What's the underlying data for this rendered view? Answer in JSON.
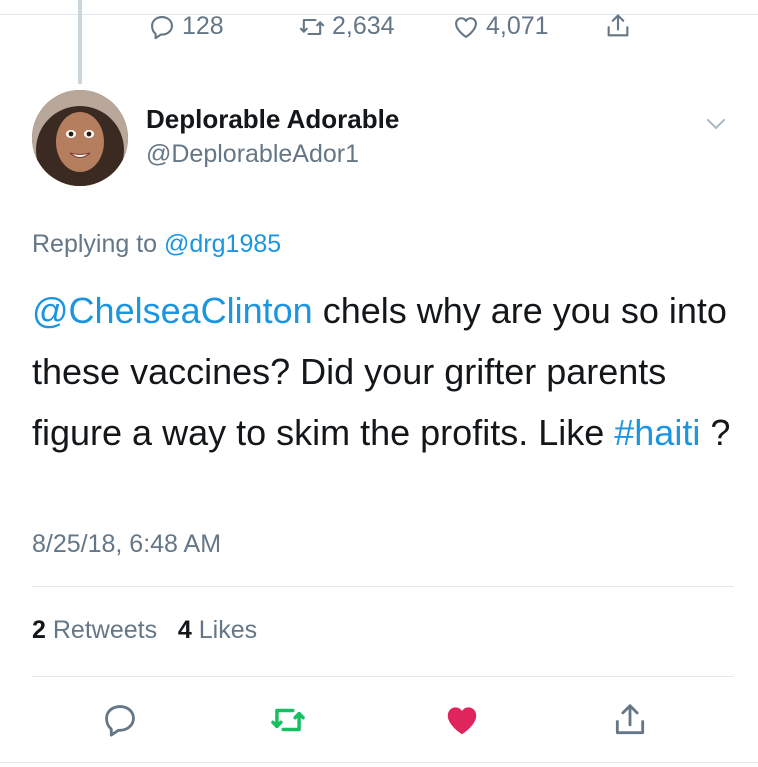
{
  "previous_tweet": {
    "reply_count": "128",
    "retweet_count": "2,634",
    "like_count": "4,071"
  },
  "author": {
    "name": "Deplorable Adorable",
    "handle": "@DeplorableAdor1"
  },
  "replying": {
    "prefix": "Replying to",
    "mention": "@drg1985"
  },
  "tweet": {
    "mention": "@ChelseaClinton",
    "text_1": " chels why are you so into these vaccines? Did your grifter parents figure a way to skim the profits. Like ",
    "hashtag": "#haiti",
    "text_2": " ?",
    "timestamp": "8/25/18, 6:48 AM"
  },
  "stats": {
    "retweets_count": "2",
    "retweets_label": "Retweets",
    "likes_count": "4",
    "likes_label": "Likes"
  },
  "icons": {
    "reply": "reply-icon",
    "retweet": "retweet-icon",
    "like": "heart-icon",
    "share": "share-icon",
    "menu": "chevron-down-icon"
  },
  "colors": {
    "link": "#1b95e0",
    "secondary_text": "#657786",
    "retweet_active": "#17bf63",
    "like_active": "#e0245e",
    "divider": "#e1e8ed"
  }
}
